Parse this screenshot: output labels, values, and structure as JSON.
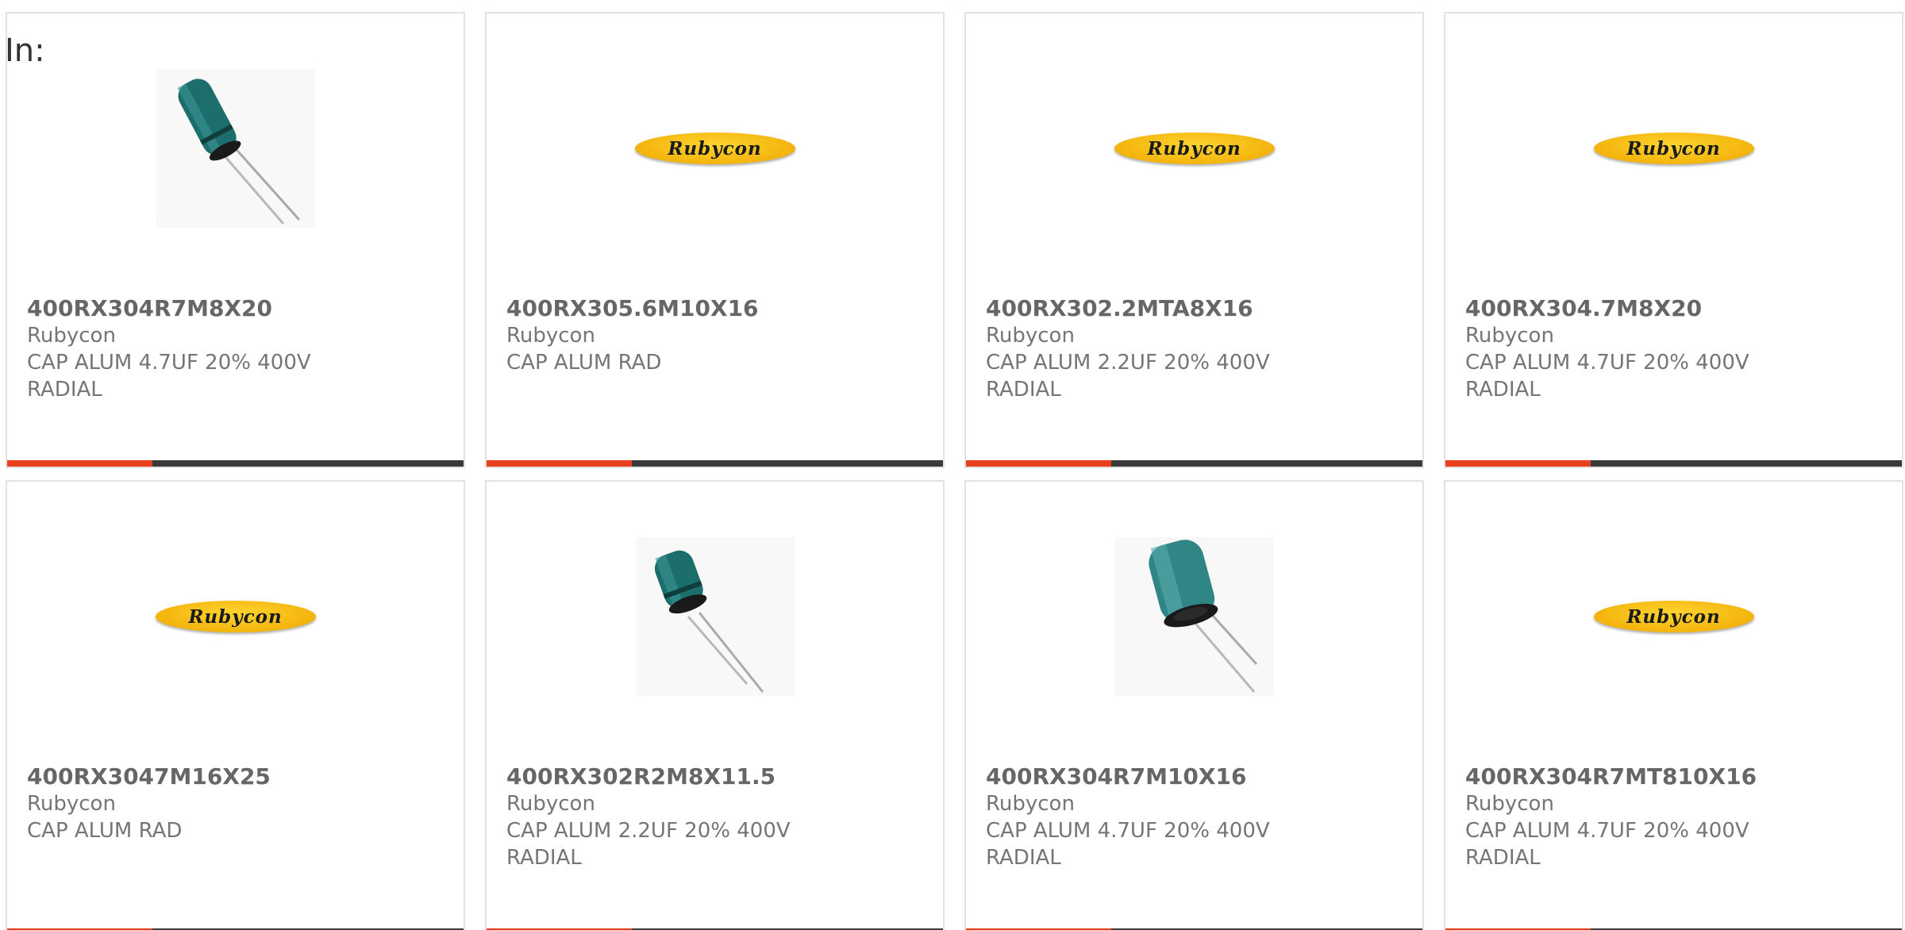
{
  "page": {
    "label": "In:"
  },
  "colors": {
    "accent": "#e8401c",
    "bar": "#3a3a3a",
    "card_border": "#e2e2e2",
    "logo_yellow": "#f3b40c"
  },
  "products": [
    {
      "part_number": "400RX304R7M8X20",
      "manufacturer": "Rubycon",
      "description": "CAP ALUM 4.7UF 20% 400V RADIAL",
      "image": "capacitor-photo-tall"
    },
    {
      "part_number": "400RX305.6M10X16",
      "manufacturer": "Rubycon",
      "description": "CAP ALUM RAD",
      "image": "rubycon-logo",
      "logo_text": "Rubycon"
    },
    {
      "part_number": "400RX302.2MTA8X16",
      "manufacturer": "Rubycon",
      "description": "CAP ALUM 2.2UF 20% 400V RADIAL",
      "image": "rubycon-logo",
      "logo_text": "Rubycon"
    },
    {
      "part_number": "400RX304.7M8X20",
      "manufacturer": "Rubycon",
      "description": "CAP ALUM 4.7UF 20% 400V RADIAL",
      "image": "rubycon-logo",
      "logo_text": "Rubycon"
    },
    {
      "part_number": "400RX3047M16X25",
      "manufacturer": "Rubycon",
      "description": "CAP ALUM RAD",
      "image": "rubycon-logo",
      "logo_text": "Rubycon"
    },
    {
      "part_number": "400RX302R2M8X11.5",
      "manufacturer": "Rubycon",
      "description": "CAP ALUM 2.2UF 20% 400V RADIAL",
      "image": "capacitor-photo-short"
    },
    {
      "part_number": "400RX304R7M10X16",
      "manufacturer": "Rubycon",
      "description": "CAP ALUM 4.7UF 20% 400V RADIAL",
      "image": "capacitor-photo-wide"
    },
    {
      "part_number": "400RX304R7MT810X16",
      "manufacturer": "Rubycon",
      "description": "CAP ALUM 4.7UF 20% 400V RADIAL",
      "image": "rubycon-logo",
      "logo_text": "Rubycon"
    }
  ]
}
